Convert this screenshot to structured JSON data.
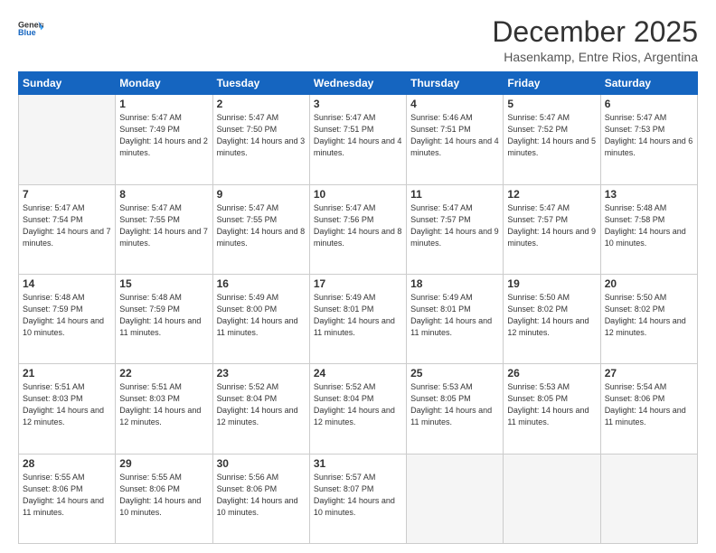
{
  "header": {
    "logo_general": "General",
    "logo_blue": "Blue",
    "month_title": "December 2025",
    "location": "Hasenkamp, Entre Rios, Argentina"
  },
  "days_of_week": [
    "Sunday",
    "Monday",
    "Tuesday",
    "Wednesday",
    "Thursday",
    "Friday",
    "Saturday"
  ],
  "weeks": [
    [
      {
        "day": "",
        "info": ""
      },
      {
        "day": "1",
        "info": "Sunrise: 5:47 AM\nSunset: 7:49 PM\nDaylight: 14 hours\nand 2 minutes."
      },
      {
        "day": "2",
        "info": "Sunrise: 5:47 AM\nSunset: 7:50 PM\nDaylight: 14 hours\nand 3 minutes."
      },
      {
        "day": "3",
        "info": "Sunrise: 5:47 AM\nSunset: 7:51 PM\nDaylight: 14 hours\nand 4 minutes."
      },
      {
        "day": "4",
        "info": "Sunrise: 5:46 AM\nSunset: 7:51 PM\nDaylight: 14 hours\nand 4 minutes."
      },
      {
        "day": "5",
        "info": "Sunrise: 5:47 AM\nSunset: 7:52 PM\nDaylight: 14 hours\nand 5 minutes."
      },
      {
        "day": "6",
        "info": "Sunrise: 5:47 AM\nSunset: 7:53 PM\nDaylight: 14 hours\nand 6 minutes."
      }
    ],
    [
      {
        "day": "7",
        "info": "Sunrise: 5:47 AM\nSunset: 7:54 PM\nDaylight: 14 hours\nand 7 minutes."
      },
      {
        "day": "8",
        "info": "Sunrise: 5:47 AM\nSunset: 7:55 PM\nDaylight: 14 hours\nand 7 minutes."
      },
      {
        "day": "9",
        "info": "Sunrise: 5:47 AM\nSunset: 7:55 PM\nDaylight: 14 hours\nand 8 minutes."
      },
      {
        "day": "10",
        "info": "Sunrise: 5:47 AM\nSunset: 7:56 PM\nDaylight: 14 hours\nand 8 minutes."
      },
      {
        "day": "11",
        "info": "Sunrise: 5:47 AM\nSunset: 7:57 PM\nDaylight: 14 hours\nand 9 minutes."
      },
      {
        "day": "12",
        "info": "Sunrise: 5:47 AM\nSunset: 7:57 PM\nDaylight: 14 hours\nand 9 minutes."
      },
      {
        "day": "13",
        "info": "Sunrise: 5:48 AM\nSunset: 7:58 PM\nDaylight: 14 hours\nand 10 minutes."
      }
    ],
    [
      {
        "day": "14",
        "info": "Sunrise: 5:48 AM\nSunset: 7:59 PM\nDaylight: 14 hours\nand 10 minutes."
      },
      {
        "day": "15",
        "info": "Sunrise: 5:48 AM\nSunset: 7:59 PM\nDaylight: 14 hours\nand 11 minutes."
      },
      {
        "day": "16",
        "info": "Sunrise: 5:49 AM\nSunset: 8:00 PM\nDaylight: 14 hours\nand 11 minutes."
      },
      {
        "day": "17",
        "info": "Sunrise: 5:49 AM\nSunset: 8:01 PM\nDaylight: 14 hours\nand 11 minutes."
      },
      {
        "day": "18",
        "info": "Sunrise: 5:49 AM\nSunset: 8:01 PM\nDaylight: 14 hours\nand 11 minutes."
      },
      {
        "day": "19",
        "info": "Sunrise: 5:50 AM\nSunset: 8:02 PM\nDaylight: 14 hours\nand 12 minutes."
      },
      {
        "day": "20",
        "info": "Sunrise: 5:50 AM\nSunset: 8:02 PM\nDaylight: 14 hours\nand 12 minutes."
      }
    ],
    [
      {
        "day": "21",
        "info": "Sunrise: 5:51 AM\nSunset: 8:03 PM\nDaylight: 14 hours\nand 12 minutes."
      },
      {
        "day": "22",
        "info": "Sunrise: 5:51 AM\nSunset: 8:03 PM\nDaylight: 14 hours\nand 12 minutes."
      },
      {
        "day": "23",
        "info": "Sunrise: 5:52 AM\nSunset: 8:04 PM\nDaylight: 14 hours\nand 12 minutes."
      },
      {
        "day": "24",
        "info": "Sunrise: 5:52 AM\nSunset: 8:04 PM\nDaylight: 14 hours\nand 12 minutes."
      },
      {
        "day": "25",
        "info": "Sunrise: 5:53 AM\nSunset: 8:05 PM\nDaylight: 14 hours\nand 11 minutes."
      },
      {
        "day": "26",
        "info": "Sunrise: 5:53 AM\nSunset: 8:05 PM\nDaylight: 14 hours\nand 11 minutes."
      },
      {
        "day": "27",
        "info": "Sunrise: 5:54 AM\nSunset: 8:06 PM\nDaylight: 14 hours\nand 11 minutes."
      }
    ],
    [
      {
        "day": "28",
        "info": "Sunrise: 5:55 AM\nSunset: 8:06 PM\nDaylight: 14 hours\nand 11 minutes."
      },
      {
        "day": "29",
        "info": "Sunrise: 5:55 AM\nSunset: 8:06 PM\nDaylight: 14 hours\nand 10 minutes."
      },
      {
        "day": "30",
        "info": "Sunrise: 5:56 AM\nSunset: 8:06 PM\nDaylight: 14 hours\nand 10 minutes."
      },
      {
        "day": "31",
        "info": "Sunrise: 5:57 AM\nSunset: 8:07 PM\nDaylight: 14 hours\nand 10 minutes."
      },
      {
        "day": "",
        "info": ""
      },
      {
        "day": "",
        "info": ""
      },
      {
        "day": "",
        "info": ""
      }
    ]
  ]
}
